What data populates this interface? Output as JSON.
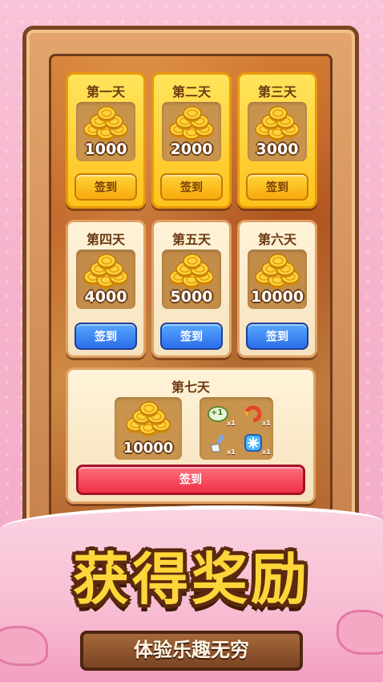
{
  "days": [
    {
      "label": "第一天",
      "amount": "1000",
      "button": "签到",
      "state": "gold-yellow"
    },
    {
      "label": "第二天",
      "amount": "2000",
      "button": "签到",
      "state": "gold-yellow"
    },
    {
      "label": "第三天",
      "amount": "3000",
      "button": "签到",
      "state": "gold-yellow"
    },
    {
      "label": "第四天",
      "amount": "4000",
      "button": "签到",
      "state": "cream-blue"
    },
    {
      "label": "第五天",
      "amount": "5000",
      "button": "签到",
      "state": "cream-blue"
    },
    {
      "label": "第六天",
      "amount": "10000",
      "button": "签到",
      "state": "cream-blue"
    }
  ],
  "day7": {
    "label": "第七天",
    "amount": "10000",
    "button": "签到",
    "items": [
      {
        "icon": "plus-one-icon",
        "text": "+1",
        "count": "x1"
      },
      {
        "icon": "refresh-icon",
        "count": "x1"
      },
      {
        "icon": "brush-icon",
        "count": "x1"
      },
      {
        "icon": "freeze-icon",
        "count": "x1"
      }
    ]
  },
  "banner": {
    "title": "获得奖励",
    "subtitle": "体验乐趣无穷"
  },
  "colors": {
    "background": "#f6b3cc",
    "frame": "#c9824d",
    "gold_card": "#ffc21d",
    "cream_card": "#f6e2bd",
    "yellow_button": "#f7a90c",
    "blue_button": "#2b6de8",
    "red_button": "#ef3048",
    "title": "#ffd63a"
  }
}
